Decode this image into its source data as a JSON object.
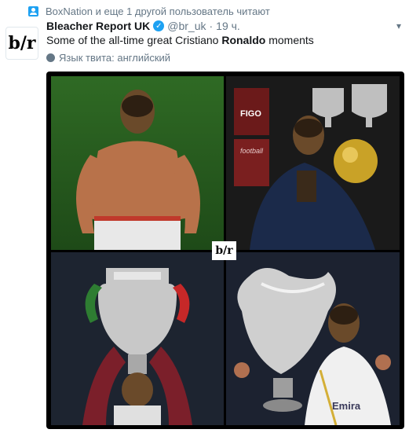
{
  "context": {
    "icon": "follow-icon",
    "text": "BoxNation и еще 1 другой пользователь читают"
  },
  "author": {
    "avatar_text": "b/r",
    "name": "Bleacher Report UK",
    "handle": "@br_uk",
    "separator": "·",
    "time": "19 ч.",
    "caret": "▾"
  },
  "tweet": {
    "text_before": "Some of the all-time great Cristiano ",
    "text_bold": "Ronaldo",
    "text_after": " moments"
  },
  "language": {
    "icon": "globe-icon",
    "text": "Язык твита: английский"
  },
  "media": {
    "badge": "b/r",
    "photos": [
      {
        "name": "shirtless-celebration-photo"
      },
      {
        "name": "ballon-dor-photo",
        "labels": [
          "FIGO",
          "football"
        ]
      },
      {
        "name": "euro-trophy-photo"
      },
      {
        "name": "champions-league-trophy-photo",
        "label": "Emira"
      }
    ]
  },
  "colors": {
    "accent": "#1da1f2",
    "secondary_text": "#657786",
    "primary_text": "#14171a"
  }
}
